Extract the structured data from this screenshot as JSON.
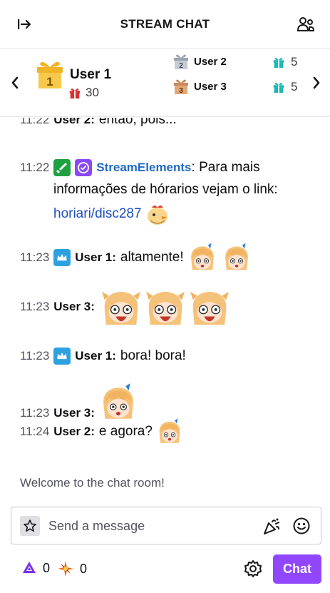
{
  "header": {
    "title": "STREAM CHAT",
    "collapse_icon": "collapse-arrow-icon",
    "users_icon": "community-users-icon"
  },
  "leaderboard": {
    "first": {
      "rank": "1",
      "user": "User 1",
      "gifts": "30"
    },
    "second": {
      "rank": "2",
      "user": "User 2",
      "gifts": "5"
    },
    "third": {
      "rank": "3",
      "user": "User 3",
      "gifts": "5"
    }
  },
  "messages": [
    {
      "time": "11:22",
      "user": "User 2:",
      "text": "entao, pois..."
    },
    {
      "time": "11:22",
      "user": "StreamElements",
      "text_line1": ": Para mais",
      "text_line2": "informações de hórarios vejam o link:",
      "link": "horiari/disc287"
    },
    {
      "time": "11:23",
      "user": "User 1:",
      "text": "altamente!"
    },
    {
      "time": "11:23",
      "user": "User 3:",
      "text": ""
    },
    {
      "time": "11:23",
      "user": "User 1:",
      "text": "bora! bora!"
    },
    {
      "time": "11:23",
      "user": "User 3:",
      "text": ""
    },
    {
      "time": "11:24",
      "user": "User 2:",
      "text": "e agora?"
    }
  ],
  "welcome": "Welcome to the chat room!",
  "input": {
    "placeholder": "Send a message",
    "value": ""
  },
  "footer": {
    "points_1": "0",
    "points_2": "0",
    "chat_label": "Chat"
  },
  "colors": {
    "accent": "#9147ff",
    "crown_badge": "#2da1e0",
    "mod_badge": "#1fa142",
    "verified_badge": "#8a48f5",
    "link": "#1f4ec2",
    "gift": "#d62f2f",
    "teal_gift": "#1bb6b6"
  }
}
